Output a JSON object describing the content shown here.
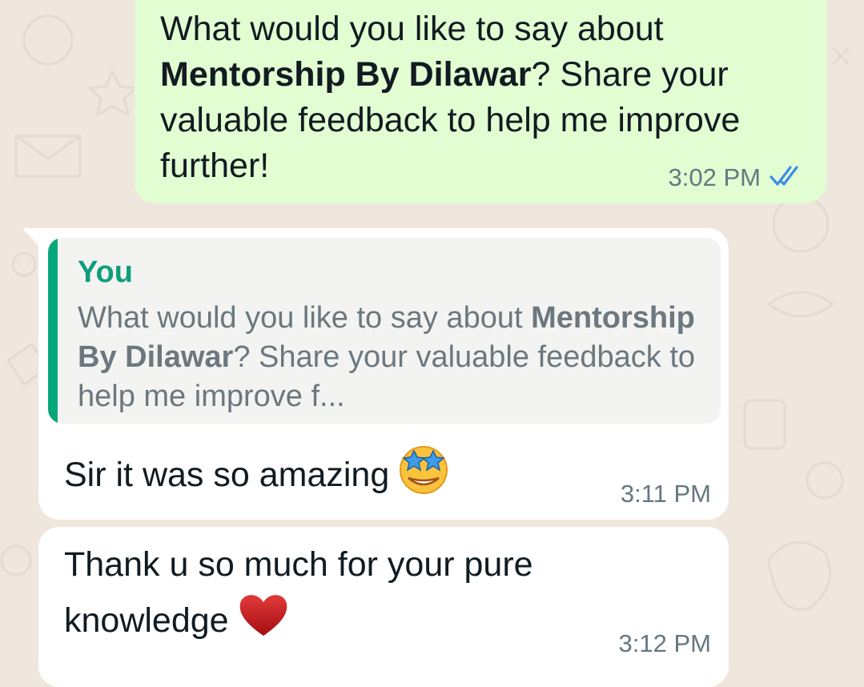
{
  "outgoing": {
    "text_before": "What would you like to say about ",
    "text_bold": "Mentorship By Dilawar",
    "text_after": "? Share your valuable feedback to help me improve further!",
    "time": "3:02 PM",
    "status_icon": "double-check-read-icon",
    "status_color": "#3e8de7"
  },
  "reply": {
    "quote_author": "You",
    "quote_before": "What would you like to say about ",
    "quote_bold": "Mentorship By Dilawar",
    "quote_after": "? Share your valuable feedback to help me improve f...",
    "text": "Sir it was so amazing",
    "emoji": "star-struck-emoji",
    "time": "3:11 PM"
  },
  "second": {
    "text": "Thank u so much for your pure knowledge",
    "emoji": "red-heart-emoji",
    "time": "3:12 PM"
  },
  "colors": {
    "wallpaper": "#efe7dd",
    "outgoing_bubble": "#e2fdd2",
    "incoming_bubble": "#ffffff",
    "quote_accent": "#06a77a"
  }
}
